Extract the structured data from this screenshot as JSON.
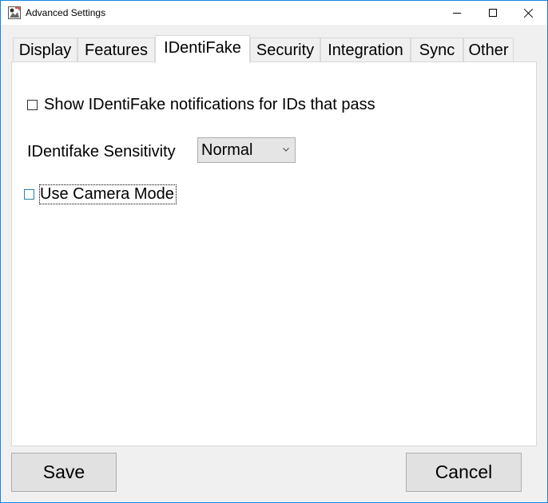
{
  "window": {
    "title": "Advanced Settings",
    "icon": "app-icon"
  },
  "tabs": [
    {
      "label": "Display",
      "active": false
    },
    {
      "label": "Features",
      "active": false
    },
    {
      "label": "IDentiFake",
      "active": true
    },
    {
      "label": "Security",
      "active": false
    },
    {
      "label": "Integration",
      "active": false
    },
    {
      "label": "Sync",
      "active": false
    },
    {
      "label": "Other",
      "active": false
    }
  ],
  "identifake": {
    "show_notifications": {
      "label": "Show IDentiFake notifications for IDs that pass",
      "checked": false
    },
    "sensitivity": {
      "label": "IDentifake Sensitivity",
      "value": "Normal"
    },
    "camera_mode": {
      "label": "Use Camera Mode",
      "checked": false
    }
  },
  "buttons": {
    "save": "Save",
    "cancel": "Cancel"
  },
  "colors": {
    "window_border": "#1883d7",
    "button_face": "#e1e1e1",
    "focus_checkbox": "#2a7fa8"
  }
}
